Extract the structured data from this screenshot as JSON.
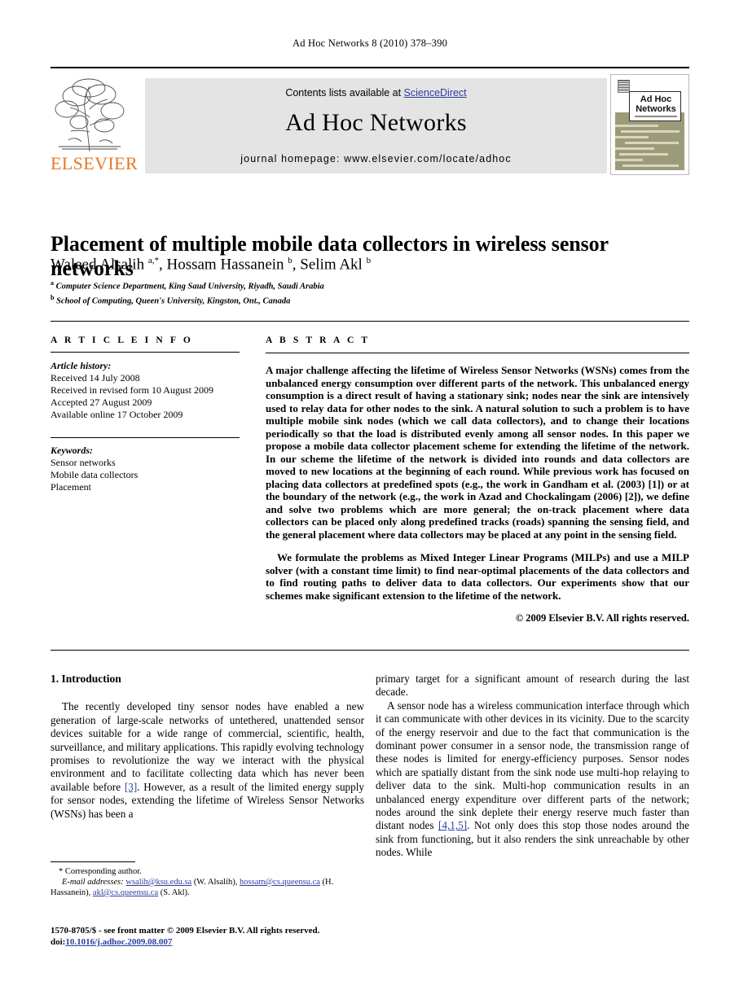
{
  "running_head": "Ad Hoc Networks 8 (2010) 378–390",
  "masthead": {
    "contents_prefix": "Contents lists available at ",
    "sciencedirect": "ScienceDirect",
    "journal_title": "Ad Hoc Networks",
    "homepage": "journal homepage: www.elsevier.com/locate/adhoc",
    "publisher_wordmark": "ELSEVIER",
    "publisher_color": "#E87722",
    "link_color": "#2b3f9e",
    "band_color": "#e4e4e4",
    "tree_icon": "elsevier-tree-icon"
  },
  "cover": {
    "title_line1": "Ad Hoc",
    "title_line2": "Networks",
    "olive_color": "#9b9b79"
  },
  "article": {
    "title": "Placement of multiple mobile data collectors in wireless sensor networks",
    "authors_html": "Waleed Alsalih <sup>a,*</sup>, Hossam Hassanein <sup>b</sup>, Selim Akl <sup>b</sup>",
    "affiliation_a": "Computer Science Department, King Saud University, Riyadh, Saudi Arabia",
    "affiliation_b": "School of Computing, Queen's University, Kingston, Ont., Canada"
  },
  "article_info": {
    "heading": "A R T I C L E    I N F O",
    "history_label": "Article history:",
    "history": [
      "Received 14 July 2008",
      "Received in revised form 10 August 2009",
      "Accepted 27 August 2009",
      "Available online 17 October 2009"
    ],
    "keywords_label": "Keywords:",
    "keywords": [
      "Sensor networks",
      "Mobile data collectors",
      "Placement"
    ]
  },
  "abstract": {
    "heading": "A B S T R A C T",
    "paragraph1": "A major challenge affecting the lifetime of Wireless Sensor Networks (WSNs) comes from the unbalanced energy consumption over different parts of the network. This unbalanced energy consumption is a direct result of having a stationary sink; nodes near the sink are intensively used to relay data for other nodes to the sink. A natural solution to such a problem is to have multiple mobile sink nodes (which we call data collectors), and to change their locations periodically so that the load is distributed evenly among all sensor nodes. In this paper we propose a mobile data collector placement scheme for extending the lifetime of the network. In our scheme the lifetime of the network is divided into rounds and data collectors are moved to new locations at the beginning of each round. While previous work has focused on placing data collectors at predefined spots (e.g., the work in Gandham et al. (2003) [1]) or at the boundary of the network (e.g., the work in Azad and Chockalingam (2006) [2]), we define and solve two problems which are more general; the on-track placement where data collectors can be placed only along predefined tracks (roads) spanning the sensing field, and the general placement where data collectors may be placed at any point in the sensing field.",
    "paragraph2": "We formulate the problems as Mixed Integer Linear Programs (MILPs) and use a MILP solver (with a constant time limit) to find near-optimal placements of the data collectors and to find routing paths to deliver data to data collectors. Our experiments show that our schemes make significant extension to the lifetime of the network.",
    "copyright": "© 2009 Elsevier B.V. All rights reserved."
  },
  "body": {
    "section_number_title": "1. Introduction",
    "left_p1": "The recently developed tiny sensor nodes have enabled a new generation of large-scale networks of untethered, unattended sensor devices suitable for a wide range of commercial, scientific, health, surveillance, and military applications. This rapidly evolving technology promises to revolutionize the way we interact with the physical environment and to facilitate collecting data which has never been available before ",
    "left_p1_ref": "[3]",
    "left_p1_cont": ". However, as a result of the limited energy supply for sensor nodes, extending the lifetime of Wireless Sensor Networks (WSNs) has been a",
    "right_p1": "primary target for a significant amount of research during the last decade.",
    "right_p2a": "A sensor node has a wireless communication interface through which it can communicate with other devices in its vicinity. Due to the scarcity of the energy reservoir and due to the fact that communication is the dominant power consumer in a sensor node, the transmission range of these nodes is limited for energy-efficiency purposes. Sensor nodes which are spatially distant from the sink node use multi-hop relaying to deliver data to the sink. Multi-hop communication results in an unbalanced energy expenditure over different parts of the network; nodes around the sink deplete their energy reserve much faster than distant nodes ",
    "right_p2_ref": "[4,1,5]",
    "right_p2b": ". Not only does this stop those nodes around the sink from functioning, but it also renders the sink unreachable by other nodes. While"
  },
  "footnote": {
    "corresponding": "* Corresponding author.",
    "email_label": "E-mail addresses:",
    "email1": "wsalih@ksu.edu.sa",
    "email1_owner": " (W. Alsalih), ",
    "email2": "hossam@cs.queensu.ca",
    "email2_owner": " (H. Hassanein), ",
    "email3": "akl@cs.queensu.ca",
    "email3_owner": " (S. Akl)."
  },
  "imprint": {
    "line1": "1570-8705/$ - see front matter © 2009 Elsevier B.V. All rights reserved.",
    "doi_label": "doi:",
    "doi_value": "10.1016/j.adhoc.2009.08.007"
  }
}
